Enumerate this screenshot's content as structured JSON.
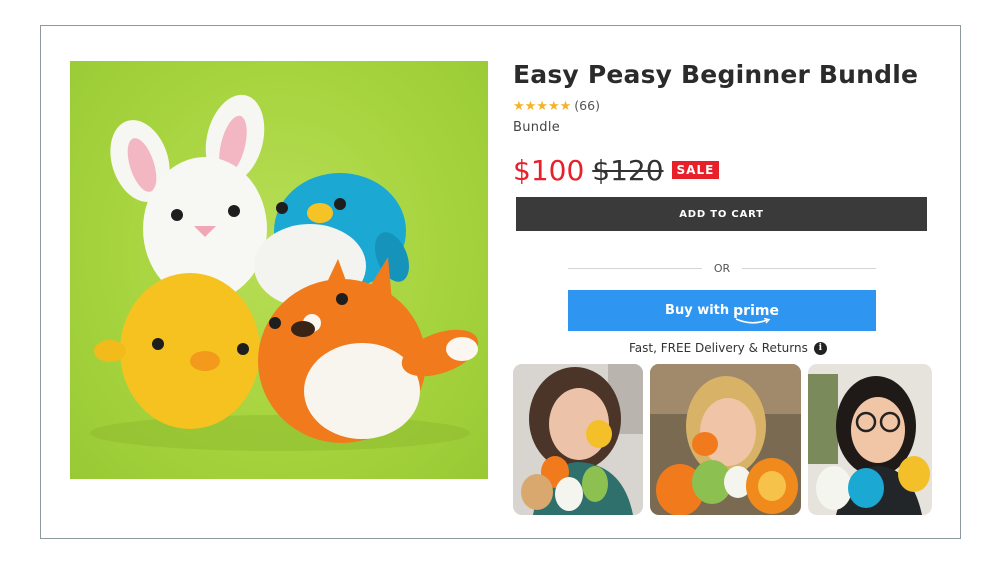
{
  "product": {
    "title": "Easy Peasy Beginner Bundle",
    "stars": "★★★★★",
    "rating_value": 5,
    "review_count": "(66)",
    "variant": "Bundle",
    "price_sale": "$100",
    "price_original": "$120",
    "sale_badge": "SALE",
    "main_image": "crochet-animals-bundle-photo"
  },
  "actions": {
    "add_to_cart": "ADD TO CART",
    "or_divider": "OR",
    "buy_with": "Buy with",
    "prime": "prime"
  },
  "delivery": {
    "text": "Fast, FREE Delivery & Returns",
    "icon": "info-icon"
  },
  "thumbnails": [
    {
      "alt": "customer-photo-1"
    },
    {
      "alt": "customer-photo-2"
    },
    {
      "alt": "customer-photo-3"
    }
  ],
  "colors": {
    "sale_red": "#e8202a",
    "cart_button": "#3a3a3a",
    "prime_blue": "#2e95f0",
    "star_gold": "#f5b323",
    "hero_green": "#a6d43e"
  }
}
